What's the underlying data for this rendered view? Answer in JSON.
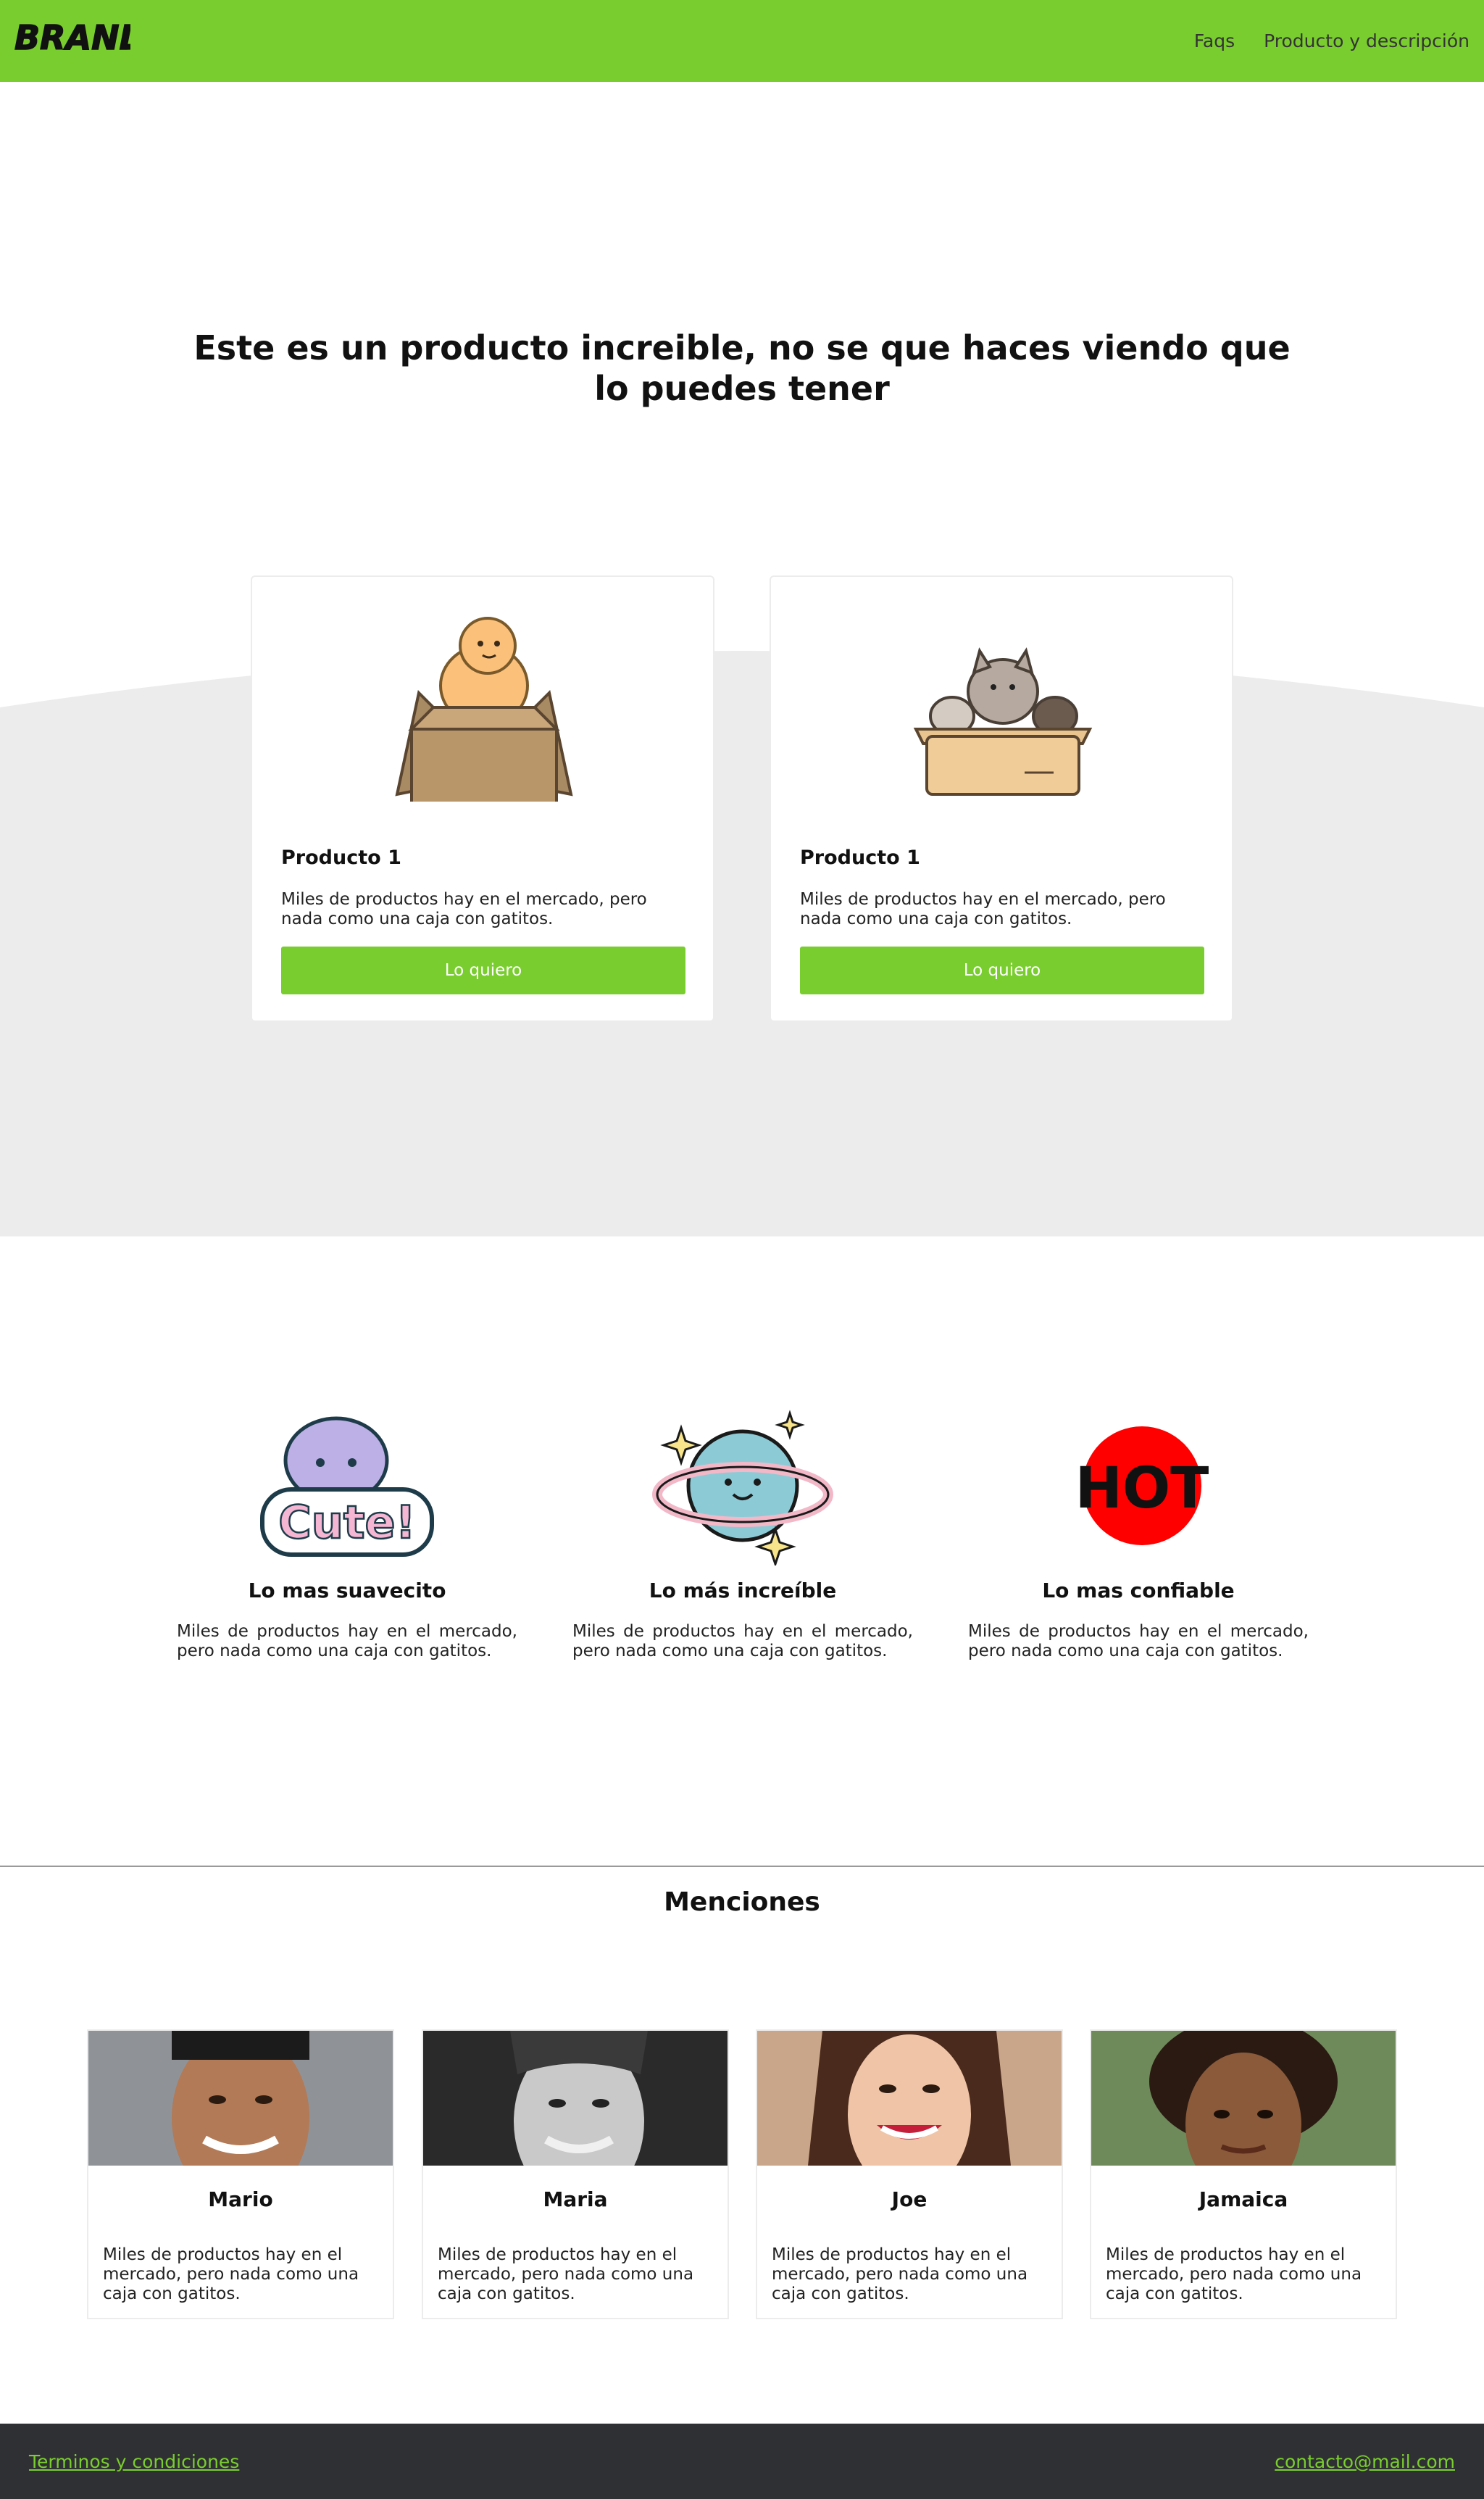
{
  "nav": {
    "brand": "BRAND",
    "links": [
      "Faqs",
      "Producto y descripción"
    ],
    "accent": "#79cd2e"
  },
  "hero": {
    "title": "Este es un producto increible, no se que haces viendo que lo puedes tener"
  },
  "products": [
    {
      "title": "Producto 1",
      "description": "Miles de productos hay en el mercado, pero nada como una caja con gatitos.",
      "button": "Lo quiero",
      "icon": "baby-in-box-illustration"
    },
    {
      "title": "Producto 1",
      "description": "Miles de productos hay en el mercado, pero nada como una caja con gatitos.",
      "button": "Lo quiero",
      "icon": "cats-in-box-illustration"
    }
  ],
  "features": [
    {
      "title": "Lo mas suavecito",
      "description": "Miles de productos hay en el mercado, pero nada como una caja con gatitos.",
      "icon": "cute-sticker-icon",
      "sticker_text": "Cute!"
    },
    {
      "title": "Lo más increíble",
      "description": "Miles de productos hay en el mercado, pero nada como una caja con gatitos.",
      "icon": "planet-icon"
    },
    {
      "title": "Lo mas confiable",
      "description": "Miles de productos hay en el mercado, pero nada como una caja con gatitos.",
      "icon": "hot-sticker-icon",
      "sticker_text": "HOT"
    }
  ],
  "mentions": {
    "title": "Menciones",
    "people": [
      {
        "name": "Mario",
        "description": "Miles de productos hay en el mercado, pero nada como una caja con gatitos."
      },
      {
        "name": "Maria",
        "description": "Miles de productos hay en el mercado, pero nada como una caja con gatitos."
      },
      {
        "name": "Joe",
        "description": "Miles de productos hay en el mercado, pero nada como una caja con gatitos."
      },
      {
        "name": "Jamaica",
        "description": "Miles de productos hay en el mercado, pero nada como una caja con gatitos."
      }
    ]
  },
  "footer": {
    "terms": "Terminos y condiciones",
    "email": "contacto@mail.com"
  }
}
